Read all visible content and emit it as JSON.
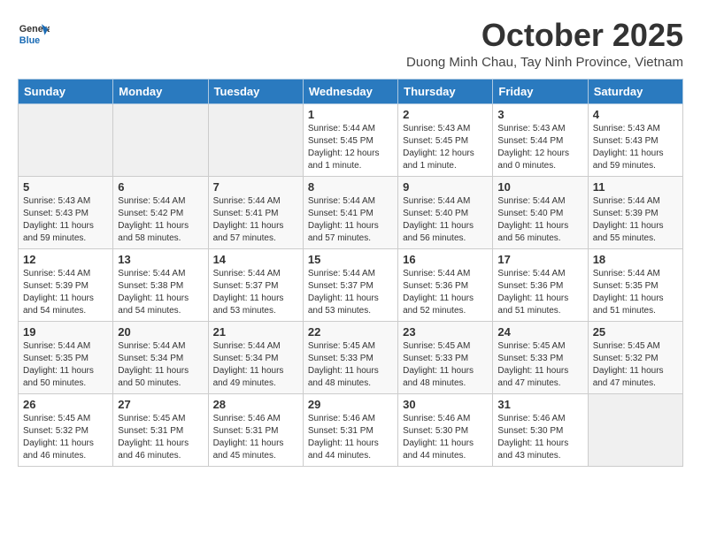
{
  "header": {
    "logo_general": "General",
    "logo_blue": "Blue",
    "month": "October 2025",
    "location": "Duong Minh Chau, Tay Ninh Province, Vietnam"
  },
  "days_of_week": [
    "Sunday",
    "Monday",
    "Tuesday",
    "Wednesday",
    "Thursday",
    "Friday",
    "Saturday"
  ],
  "weeks": [
    [
      {
        "day": "",
        "text": ""
      },
      {
        "day": "",
        "text": ""
      },
      {
        "day": "",
        "text": ""
      },
      {
        "day": "1",
        "text": "Sunrise: 5:44 AM\nSunset: 5:45 PM\nDaylight: 12 hours\nand 1 minute."
      },
      {
        "day": "2",
        "text": "Sunrise: 5:43 AM\nSunset: 5:45 PM\nDaylight: 12 hours\nand 1 minute."
      },
      {
        "day": "3",
        "text": "Sunrise: 5:43 AM\nSunset: 5:44 PM\nDaylight: 12 hours\nand 0 minutes."
      },
      {
        "day": "4",
        "text": "Sunrise: 5:43 AM\nSunset: 5:43 PM\nDaylight: 11 hours\nand 59 minutes."
      }
    ],
    [
      {
        "day": "5",
        "text": "Sunrise: 5:43 AM\nSunset: 5:43 PM\nDaylight: 11 hours\nand 59 minutes."
      },
      {
        "day": "6",
        "text": "Sunrise: 5:44 AM\nSunset: 5:42 PM\nDaylight: 11 hours\nand 58 minutes."
      },
      {
        "day": "7",
        "text": "Sunrise: 5:44 AM\nSunset: 5:41 PM\nDaylight: 11 hours\nand 57 minutes."
      },
      {
        "day": "8",
        "text": "Sunrise: 5:44 AM\nSunset: 5:41 PM\nDaylight: 11 hours\nand 57 minutes."
      },
      {
        "day": "9",
        "text": "Sunrise: 5:44 AM\nSunset: 5:40 PM\nDaylight: 11 hours\nand 56 minutes."
      },
      {
        "day": "10",
        "text": "Sunrise: 5:44 AM\nSunset: 5:40 PM\nDaylight: 11 hours\nand 56 minutes."
      },
      {
        "day": "11",
        "text": "Sunrise: 5:44 AM\nSunset: 5:39 PM\nDaylight: 11 hours\nand 55 minutes."
      }
    ],
    [
      {
        "day": "12",
        "text": "Sunrise: 5:44 AM\nSunset: 5:39 PM\nDaylight: 11 hours\nand 54 minutes."
      },
      {
        "day": "13",
        "text": "Sunrise: 5:44 AM\nSunset: 5:38 PM\nDaylight: 11 hours\nand 54 minutes."
      },
      {
        "day": "14",
        "text": "Sunrise: 5:44 AM\nSunset: 5:37 PM\nDaylight: 11 hours\nand 53 minutes."
      },
      {
        "day": "15",
        "text": "Sunrise: 5:44 AM\nSunset: 5:37 PM\nDaylight: 11 hours\nand 53 minutes."
      },
      {
        "day": "16",
        "text": "Sunrise: 5:44 AM\nSunset: 5:36 PM\nDaylight: 11 hours\nand 52 minutes."
      },
      {
        "day": "17",
        "text": "Sunrise: 5:44 AM\nSunset: 5:36 PM\nDaylight: 11 hours\nand 51 minutes."
      },
      {
        "day": "18",
        "text": "Sunrise: 5:44 AM\nSunset: 5:35 PM\nDaylight: 11 hours\nand 51 minutes."
      }
    ],
    [
      {
        "day": "19",
        "text": "Sunrise: 5:44 AM\nSunset: 5:35 PM\nDaylight: 11 hours\nand 50 minutes."
      },
      {
        "day": "20",
        "text": "Sunrise: 5:44 AM\nSunset: 5:34 PM\nDaylight: 11 hours\nand 50 minutes."
      },
      {
        "day": "21",
        "text": "Sunrise: 5:44 AM\nSunset: 5:34 PM\nDaylight: 11 hours\nand 49 minutes."
      },
      {
        "day": "22",
        "text": "Sunrise: 5:45 AM\nSunset: 5:33 PM\nDaylight: 11 hours\nand 48 minutes."
      },
      {
        "day": "23",
        "text": "Sunrise: 5:45 AM\nSunset: 5:33 PM\nDaylight: 11 hours\nand 48 minutes."
      },
      {
        "day": "24",
        "text": "Sunrise: 5:45 AM\nSunset: 5:33 PM\nDaylight: 11 hours\nand 47 minutes."
      },
      {
        "day": "25",
        "text": "Sunrise: 5:45 AM\nSunset: 5:32 PM\nDaylight: 11 hours\nand 47 minutes."
      }
    ],
    [
      {
        "day": "26",
        "text": "Sunrise: 5:45 AM\nSunset: 5:32 PM\nDaylight: 11 hours\nand 46 minutes."
      },
      {
        "day": "27",
        "text": "Sunrise: 5:45 AM\nSunset: 5:31 PM\nDaylight: 11 hours\nand 46 minutes."
      },
      {
        "day": "28",
        "text": "Sunrise: 5:46 AM\nSunset: 5:31 PM\nDaylight: 11 hours\nand 45 minutes."
      },
      {
        "day": "29",
        "text": "Sunrise: 5:46 AM\nSunset: 5:31 PM\nDaylight: 11 hours\nand 44 minutes."
      },
      {
        "day": "30",
        "text": "Sunrise: 5:46 AM\nSunset: 5:30 PM\nDaylight: 11 hours\nand 44 minutes."
      },
      {
        "day": "31",
        "text": "Sunrise: 5:46 AM\nSunset: 5:30 PM\nDaylight: 11 hours\nand 43 minutes."
      },
      {
        "day": "",
        "text": ""
      }
    ]
  ]
}
